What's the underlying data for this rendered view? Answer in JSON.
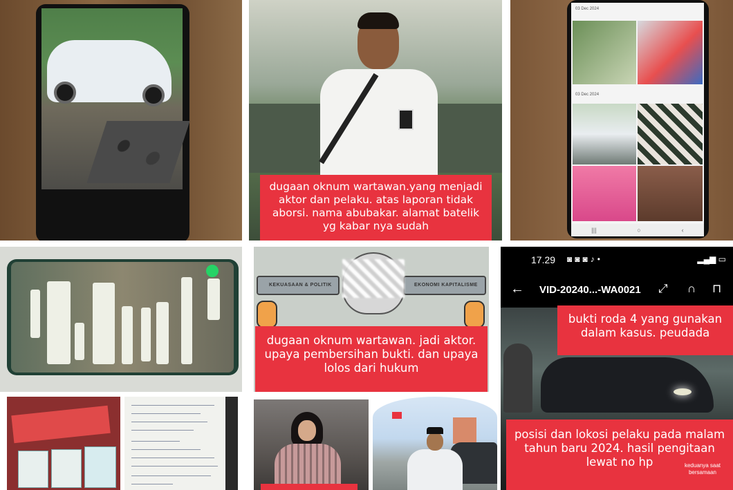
{
  "captions": {
    "t2": "dugaan oknum wartawan.yang menjadi aktor dan pelaku. atas laporan tidak aborsi. nama abubakar. alamat batelik yg kabar nya sudah",
    "t5": "dugaan oknum wartawan. jadi aktor. upaya pembersihan bukti. dan upaya lolos dari hukum",
    "t6_top": "bukti roda 4 yang gunakan dalam kasus. peudada",
    "t6_bottom": "posisi dan lokosi pelaku pada malam tahun baru 2024. hasil pengitaan lewat no hp",
    "t6_small": "keduanya saat bersamaan"
  },
  "video": {
    "time": "17.29",
    "status_right": "···",
    "title": "VID-20240...-WA0021",
    "back_icon": "arrow-left-icon",
    "icons": [
      "expand-icon",
      "headphones-icon",
      "unlock-icon"
    ]
  },
  "gallery": {
    "date1": "03 Dec 2024",
    "date2": "03 Dec 2024"
  },
  "cartoon": {
    "left_label": "KEKUASAAN & POLITIK",
    "right_label": "EKONOMI KAPITALISME"
  },
  "colors": {
    "caption_red": "#e8333f"
  }
}
